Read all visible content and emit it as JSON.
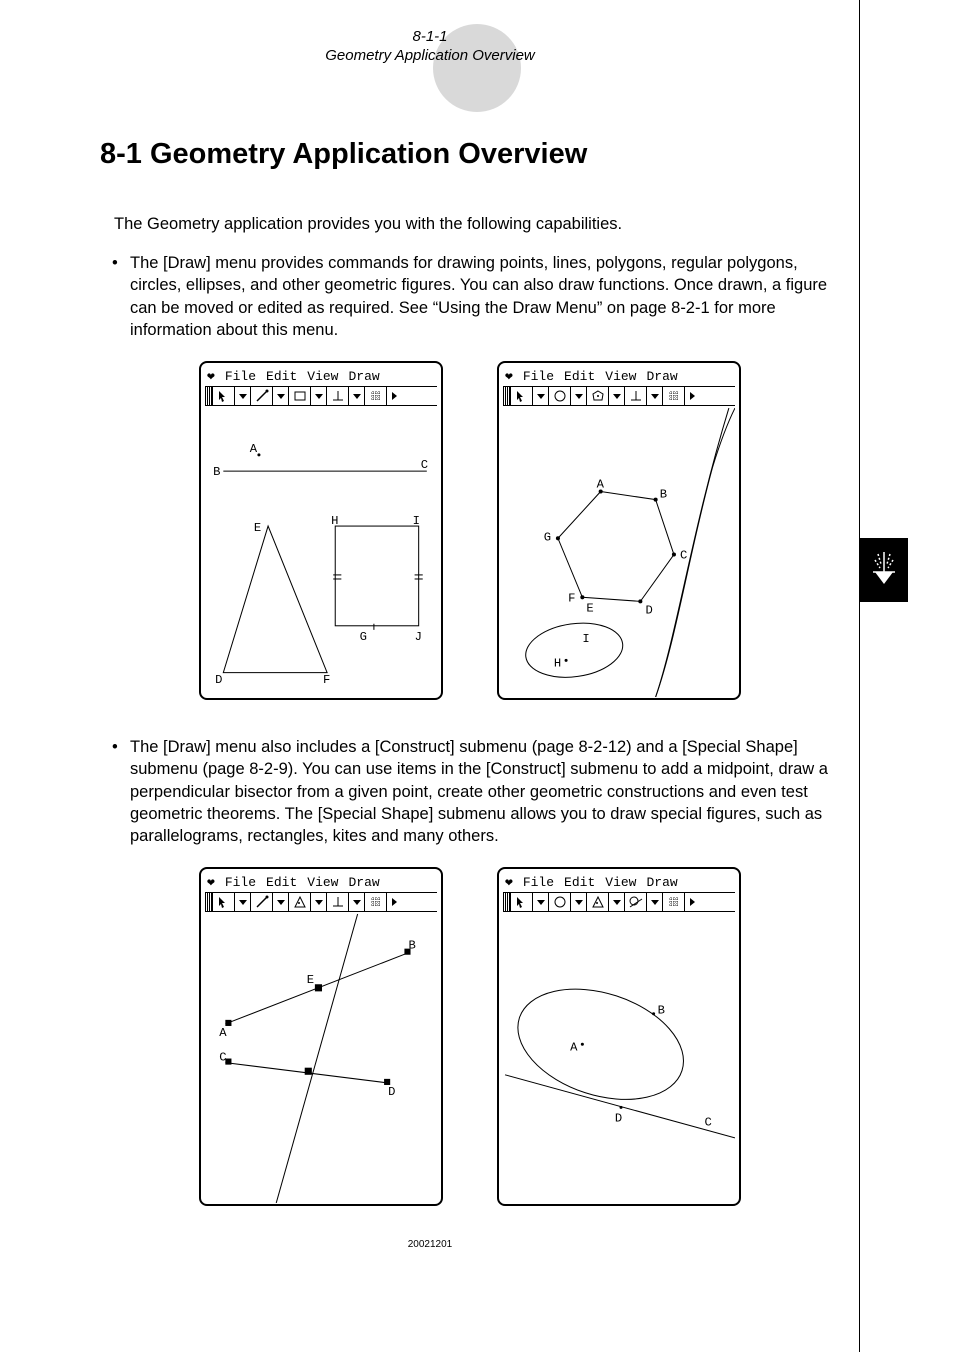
{
  "header": {
    "pagecode": "8-1-1",
    "subtitle": "Geometry Application Overview"
  },
  "h1": "8-1 Geometry Application Overview",
  "intro": "The Geometry application provides you with the following capabilities.",
  "bullet1": "The [Draw] menu provides commands for drawing points, lines, polygons, regular polygons, circles, ellipses, and other geometric figures. You can also draw functions. Once drawn, a figure can be moved or edited as required. See “Using the Draw Menu” on page 8-2-1 for more information about this menu.",
  "bullet2": "The [Draw] menu also includes a [Construct] submenu (page 8-2-12) and a [Special Shape] submenu (page 8-2-9). You can use items in the [Construct] submenu to add a midpoint, draw a perpendicular bisector from a given point, create other geometric constructions and even test geometric theorems. The [Special Shape] submenu allows you to draw special figures, such as parallelograms, rectangles, kites and many others.",
  "menus": {
    "file": "File",
    "edit": "Edit",
    "view": "View",
    "draw": "Draw"
  },
  "screenshots": {
    "a": {
      "labels": [
        "A",
        "B",
        "C",
        "D",
        "E",
        "F",
        "G",
        "H",
        "I",
        "J"
      ]
    },
    "b": {
      "labels": [
        "A",
        "B",
        "C",
        "D",
        "E",
        "F",
        "G",
        "H",
        "I"
      ]
    },
    "c": {
      "labels": [
        "A",
        "B",
        "C",
        "D",
        "E"
      ]
    },
    "d": {
      "labels": [
        "A",
        "B",
        "C",
        "D"
      ]
    }
  },
  "footer": "20021201"
}
